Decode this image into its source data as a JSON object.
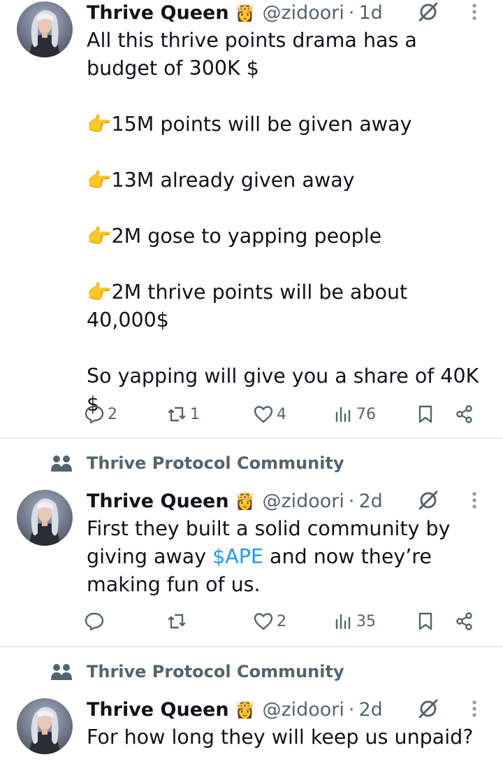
{
  "tweets": [
    {
      "author": "Thrive Queen",
      "badge_emoji": "👸",
      "handle": "@zidoori",
      "time": "1d",
      "text": "All this thrive points drama has a budget of 300K $\n\n👉15M points will be given away\n\n👉13M already given away\n\n👉2M gose to yapping people\n\n👉2M thrive points will be about 40,000$\n\nSo yapping will give you a share of 40K $",
      "replies": "2",
      "reposts": "1",
      "likes": "4",
      "views": "76"
    },
    {
      "community": "Thrive Protocol Community",
      "author": "Thrive Queen",
      "badge_emoji": "👸",
      "handle": "@zidoori",
      "time": "2d",
      "text_before": "First they built a solid community by giving away ",
      "cashtag": "$APE",
      "text_after": " and now they’re making fun of us.",
      "replies": "",
      "reposts": "",
      "likes": "2",
      "views": "35"
    },
    {
      "community": "Thrive Protocol Community",
      "author": "Thrive Queen",
      "badge_emoji": "👸",
      "handle": "@zidoori",
      "time": "2d",
      "text": "For how long they will keep us unpaid?"
    }
  ],
  "colors": {
    "text": "#0f1419",
    "secondary": "#536471",
    "link": "#1d9bf0",
    "divider": "#cfd9de"
  }
}
